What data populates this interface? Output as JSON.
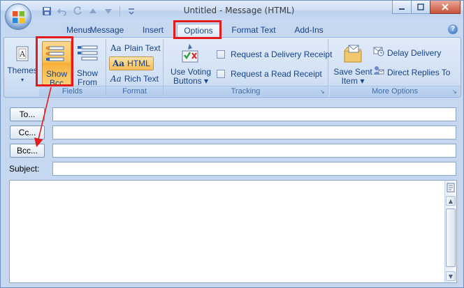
{
  "window": {
    "title": "Untitled - Message (HTML)",
    "controls": {
      "minimize": "—",
      "maximize": "☐",
      "close": "✕"
    }
  },
  "quick_access": {
    "save_icon": "save-icon",
    "undo_icon": "undo-icon",
    "redo_icon": "redo-icon",
    "up_icon": "previous-item-icon",
    "down_icon": "next-item-icon",
    "customize_icon": "customize-qat-icon"
  },
  "tabs": [
    {
      "label": "Menus"
    },
    {
      "label": "Message"
    },
    {
      "label": "Insert"
    },
    {
      "label": "Options",
      "active": true
    },
    {
      "label": "Format Text"
    },
    {
      "label": "Add-Ins"
    }
  ],
  "help": "?",
  "ribbon": {
    "themes": {
      "label": "Themes",
      "dropdown": "▾"
    },
    "fields": {
      "group_label": "Fields",
      "show_bcc": {
        "line1": "Show",
        "line2": "Bcc",
        "pressed": true
      },
      "show_from": {
        "line1": "Show",
        "line2": "From"
      }
    },
    "format": {
      "group_label": "Format",
      "plain_text": "Plain Text",
      "html": "HTML",
      "rich_text": "Rich Text",
      "aa": "Aa"
    },
    "tracking": {
      "group_label": "Tracking",
      "use_voting": {
        "line1": "Use Voting",
        "line2": "Buttons ▾"
      },
      "delivery_receipt": "Request a Delivery Receipt",
      "read_receipt": "Request a Read Receipt"
    },
    "more_options": {
      "group_label": "More Options",
      "save_sent": {
        "line1": "Save Sent",
        "line2": "Item ▾"
      },
      "delay_delivery": "Delay Delivery",
      "direct_replies": "Direct Replies To"
    },
    "launcher": "↘"
  },
  "address": {
    "to_label": "To...",
    "cc_label": "Cc...",
    "bcc_label": "Bcc...",
    "subject_label": "Subject:",
    "to_value": "",
    "cc_value": "",
    "bcc_value": "",
    "subject_value": ""
  },
  "body": {
    "text": ""
  },
  "colors": {
    "highlight": "#e31b1b",
    "pressed": "#f9c35d",
    "ribbon_text": "#15428b"
  }
}
